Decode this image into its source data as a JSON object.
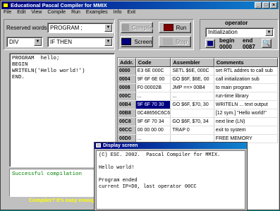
{
  "window": {
    "title": "Educational Pascal Compiler for MMIX",
    "minimize": "_",
    "maximize": "□",
    "close": "×"
  },
  "menu": [
    "File",
    "Edit",
    "View",
    "Compile",
    "Run",
    "Examples",
    "Info",
    "Exit"
  ],
  "reserved_words": {
    "label": "Reserved words:",
    "selected": "PROGRAM ;",
    "left_selected": "DIV",
    "right_selected": "IF THEN"
  },
  "buttons": {
    "compile": "Compile",
    "run": "Run",
    "screen": "Screen",
    "stop": "Stop"
  },
  "operator": {
    "label": "operator",
    "selected": "Initialization",
    "begin_label": "begin",
    "begin_value": "0000",
    "end_label": "end",
    "end_value": "0087"
  },
  "editor_text": "PROGRAM  hello;\nBEGIN\nWRITELN('Hello world!')\nEND.",
  "status_text": "Successful compilation",
  "slogan": "Compiler? It's easy enough!",
  "table": {
    "headers": [
      "Addr.",
      "Code",
      "Assembler",
      "Comments"
    ],
    "rows": [
      [
        "0000",
        "E3 6E 000C",
        "SETL $6E, 000C",
        "set RTL addres to call sub"
      ],
      [
        "0004",
        "9F 6F 6E 00",
        "GO $6F, $6E, 00",
        "call initialization sub"
      ],
      [
        "0008",
        "F0 00002B",
        "JMP ==> 00B4",
        "to main program"
      ],
      [
        "000C",
        "...",
        "...",
        "run-time library"
      ],
      [
        "00B4",
        "9F 6F 70 30",
        "GO $6F, $70, 30",
        "WRITELN ... text output"
      ],
      [
        "00B8",
        "0C48656C6C6",
        "",
        "[12 sym.] \"Hello world!\""
      ],
      [
        "00C8",
        "9F 6F 70 34",
        "GO $6F, $70, 34",
        "next line (LN)"
      ],
      [
        "00CC",
        "00 00 00 00",
        "TRAP 0",
        "exit to system"
      ],
      [
        "00D0",
        "...",
        "",
        "FREE MEMORY"
      ]
    ],
    "selected_row": 4
  },
  "display_screen": {
    "title": "Display screen",
    "text": "(C) ESC. 2002.  Pascal Compiler for MMIX.\n\nHello world!\n\nProgram ended\ncurrent IP=D0, last operator 00CC"
  }
}
